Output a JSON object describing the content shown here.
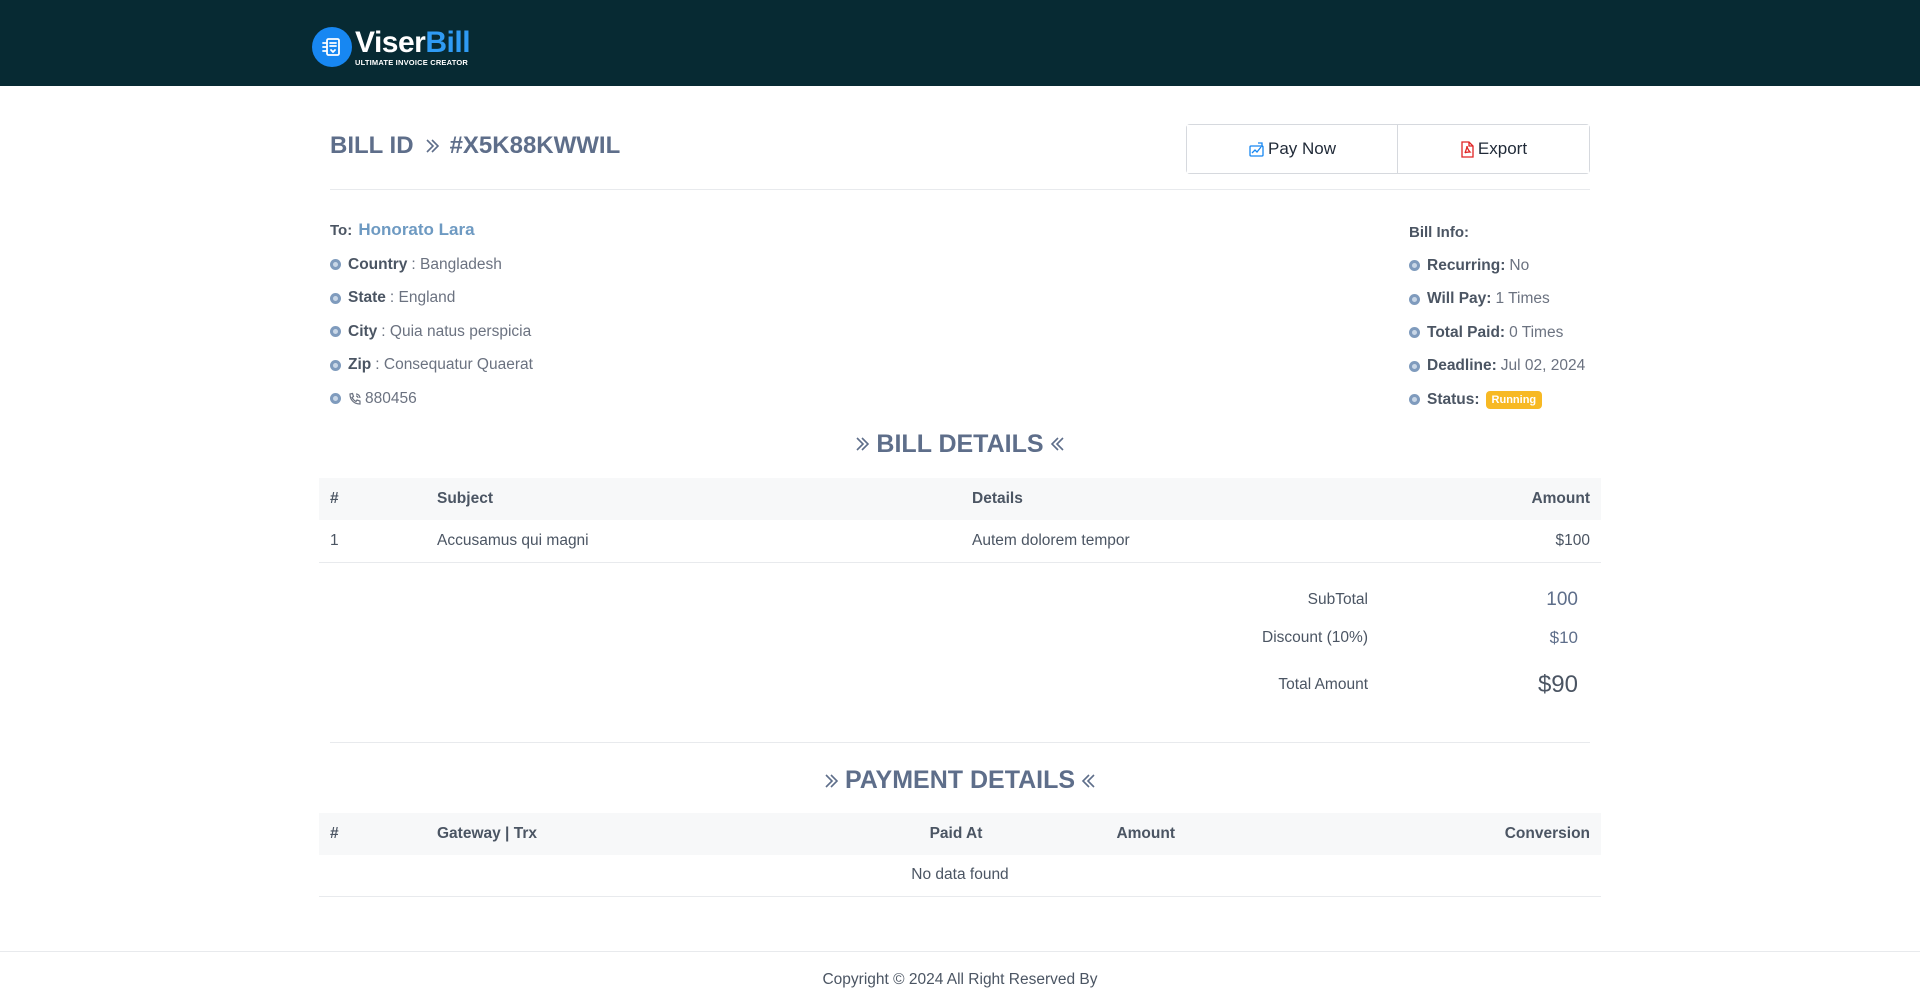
{
  "brand": {
    "name_part1": "Viser",
    "name_part2": "Bill",
    "tagline": "ULTIMATE INVOICE CREATOR",
    "colors": {
      "header_bg": "#072a33",
      "accent": "#1787f2",
      "badge": "#f7b924"
    }
  },
  "bill": {
    "label": "BILL ID",
    "id": "#X5K88KWWIL"
  },
  "actions": {
    "pay_label": "Pay Now",
    "export_label": "Export"
  },
  "recipient": {
    "to_label": "To:",
    "name": "Honorato Lara",
    "country_label": "Country",
    "country": "Bangladesh",
    "state_label": "State",
    "state": "England",
    "city_label": "City",
    "city": "Quia natus perspicia",
    "zip_label": "Zip",
    "zip": "Consequatur Quaerat",
    "phone": "880456"
  },
  "bill_info": {
    "title": "Bill Info:",
    "recurring_label": "Recurring:",
    "recurring": "No",
    "will_pay_label": "Will Pay:",
    "will_pay": "1 Times",
    "total_paid_label": "Total Paid:",
    "total_paid": "0 Times",
    "deadline_label": "Deadline:",
    "deadline": "Jul 02, 2024",
    "status_label": "Status:",
    "status": "Running"
  },
  "bill_details": {
    "title": "BILL DETAILS",
    "headers": [
      "#",
      "Subject",
      "Details",
      "Amount"
    ],
    "rows": [
      [
        "1",
        "Accusamus qui magni",
        "Autem dolorem tempor",
        "$100"
      ]
    ]
  },
  "totals": {
    "subtotal_label": "SubTotal",
    "subtotal": "100",
    "discount_label": "Discount (10%)",
    "discount": "$10",
    "total_label": "Total Amount",
    "total": "$90"
  },
  "payment_details": {
    "title": "PAYMENT DETAILS",
    "headers": [
      "#",
      "Gateway | Trx",
      "Paid At",
      "Amount",
      "Conversion"
    ],
    "empty_text": "No data found"
  },
  "footer": {
    "copyright": "Copyright © 2024 All Right Reserved By"
  }
}
